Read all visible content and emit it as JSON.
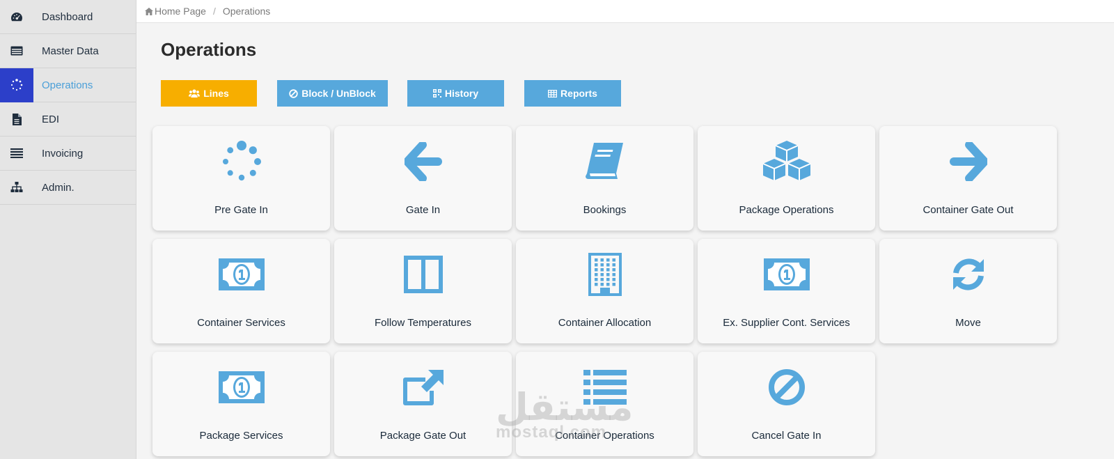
{
  "sidebar": {
    "items": [
      {
        "label": "Dashboard",
        "icon": "dashboard-icon"
      },
      {
        "label": "Master Data",
        "icon": "table-icon"
      },
      {
        "label": "Operations",
        "icon": "spinner-icon",
        "active": true
      },
      {
        "label": "EDI",
        "icon": "file-icon"
      },
      {
        "label": "Invoicing",
        "icon": "list-icon"
      },
      {
        "label": "Admin.",
        "icon": "sitemap-icon"
      }
    ]
  },
  "breadcrumb": {
    "home": "Home Page",
    "current": "Operations"
  },
  "page": {
    "title": "Operations"
  },
  "toolbar": {
    "lines": "Lines",
    "block": "Block / UnBlock",
    "history": "History",
    "reports": "Reports"
  },
  "tiles": [
    {
      "label": "Pre Gate In",
      "icon": "spinner-icon"
    },
    {
      "label": "Gate In",
      "icon": "arrow-left-icon"
    },
    {
      "label": "Bookings",
      "icon": "book-icon"
    },
    {
      "label": "Package Operations",
      "icon": "cubes-icon"
    },
    {
      "label": "Container Gate Out",
      "icon": "arrow-right-icon"
    },
    {
      "label": "Container Services",
      "icon": "money-icon"
    },
    {
      "label": "Follow Temperatures",
      "icon": "columns-icon"
    },
    {
      "label": "Container Allocation",
      "icon": "building-icon"
    },
    {
      "label": "Ex. Supplier Cont. Services",
      "icon": "money-icon"
    },
    {
      "label": "Move",
      "icon": "refresh-icon"
    },
    {
      "label": "Package Services",
      "icon": "money-icon"
    },
    {
      "label": "Package Gate Out",
      "icon": "external-link-icon"
    },
    {
      "label": "Container Operations",
      "icon": "list-icon"
    },
    {
      "label": "Cancel Gate In",
      "icon": "ban-icon"
    }
  ],
  "watermark": {
    "arabic": "مستقل",
    "latin": "mostaql.com"
  },
  "colors": {
    "accent": "#57a8dc",
    "active_sidebar": "#2c3fc9",
    "lines_button": "#f7ae00",
    "text_dark": "#1a2a3a"
  }
}
